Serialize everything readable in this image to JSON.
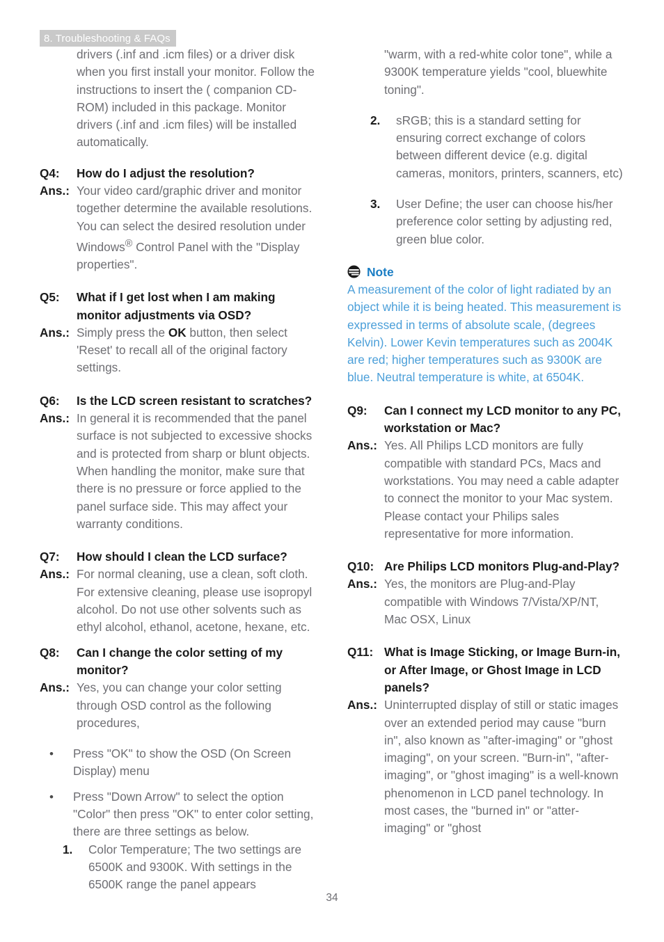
{
  "header": {
    "chapter": "8. Troubleshooting & FAQs"
  },
  "footer": {
    "page_number": "34"
  },
  "colors": {
    "header_band": "#c9c9c9",
    "header_text": "#ffffff",
    "body_text": "#6e6e73",
    "bold_text": "#1b1b1b",
    "note_title": "#1b7ec4",
    "note_body": "#4b9fd9"
  },
  "left_column": {
    "continued_paragraph": "drivers (.inf and .icm files) or a driver disk when you first install your monitor. Follow the instructions to insert the ( companion CD-ROM) included in this package. Monitor drivers (.inf and .icm files) will be installed automatically.",
    "q4": {
      "q_label": "Q4:",
      "question": "How do I adjust the resolution?",
      "a_label": "Ans.:",
      "answer_part1": "Your video card/graphic driver and monitor together determine the available resolutions. You can select the desired resolution under Windows",
      "answer_sup": "®",
      "answer_part2": " Control Panel with the \"Display properties\"."
    },
    "q5": {
      "q_label": "Q5:",
      "question": "What if I get lost when I am making monitor adjustments via OSD?",
      "a_label": "Ans.:",
      "answer_part1": "Simply press the ",
      "answer_bold": "OK",
      "answer_part2": " button, then select 'Reset' to recall all of the original factory settings."
    },
    "q6": {
      "q_label": "Q6:",
      "question": "Is the LCD screen resistant to scratches?",
      "a_label": "Ans.:",
      "answer": "In general it is recommended that the panel surface is not subjected to excessive shocks and is protected from sharp or blunt objects. When handling the monitor, make sure that there is no pressure or force applied to the panel surface side. This may affect your warranty conditions."
    },
    "q7": {
      "q_label": "Q7:",
      "question": "How should I clean the LCD surface?",
      "a_label": "Ans.:",
      "answer": "For normal cleaning, use a clean, soft cloth. For extensive cleaning, please use isopropyl alcohol. Do not use other solvents such as ethyl alcohol, ethanol, acetone, hexane, etc."
    },
    "q8": {
      "q_label": "Q8:",
      "question": "Can I change the color setting of my monitor?",
      "a_label": "Ans.:",
      "answer": "Yes, you can change your color setting through OSD control as the following procedures,"
    },
    "bullets": [
      "Press \"OK\" to show the OSD (On Screen Display) menu",
      "Press \"Down Arrow\" to select the option \"Color\" then press \"OK\" to enter color setting, there are three settings as below."
    ],
    "numbered": [
      {
        "num": "1.",
        "text": "Color Temperature; The two settings are 6500K and 9300K. With settings in the 6500K range the panel appears"
      }
    ]
  },
  "right_column": {
    "continued_paragraph": "\"warm, with a red-white color tone\", while a 9300K temperature yields \"cool, bluewhite toning\".",
    "numbered": [
      {
        "num": "2.",
        "text": "sRGB; this is a standard setting for ensuring correct exchange of colors between different device (e.g. digital cameras, monitors, printers, scanners, etc)"
      },
      {
        "num": "3.",
        "text": "User Define; the user can choose his/her preference color setting by adjusting red, green blue color."
      }
    ],
    "note": {
      "icon": "note-lines-icon",
      "title": "Note",
      "body": "A measurement of the color of light radiated by an object while it is being heated. This measurement is expressed in terms of absolute scale, (degrees Kelvin). Lower Kevin temperatures such as 2004K are red; higher temperatures such as 9300K are blue. Neutral temperature is white, at 6504K."
    },
    "q9": {
      "q_label": "Q9:",
      "question": "Can I connect my LCD monitor to any PC, workstation or Mac?",
      "a_label": "Ans.:",
      "answer": "Yes. All Philips LCD monitors are fully compatible with standard PCs, Macs and workstations. You may need a cable adapter to connect the monitor to your Mac system. Please contact your Philips sales representative for more information."
    },
    "q10": {
      "q_label": "Q10:",
      "question": "Are Philips LCD monitors Plug-and-Play?",
      "a_label": "Ans.:",
      "answer": "Yes, the monitors are Plug-and-Play compatible with Windows 7/Vista/XP/NT, Mac OSX, Linux"
    },
    "q11": {
      "q_label": "Q11:",
      "question": "What is Image Sticking, or Image Burn-in, or After Image, or Ghost Image in LCD panels?",
      "a_label": "Ans.:",
      "answer": "Uninterrupted display of still or static images over an extended period may cause \"burn in\", also known as \"after-imaging\" or \"ghost imaging\", on your screen. \"Burn-in\", \"after-imaging\", or \"ghost imaging\" is a well-known phenomenon in LCD panel technology. In most cases, the \"burned in\" or \"atter-imaging\" or \"ghost"
    }
  }
}
